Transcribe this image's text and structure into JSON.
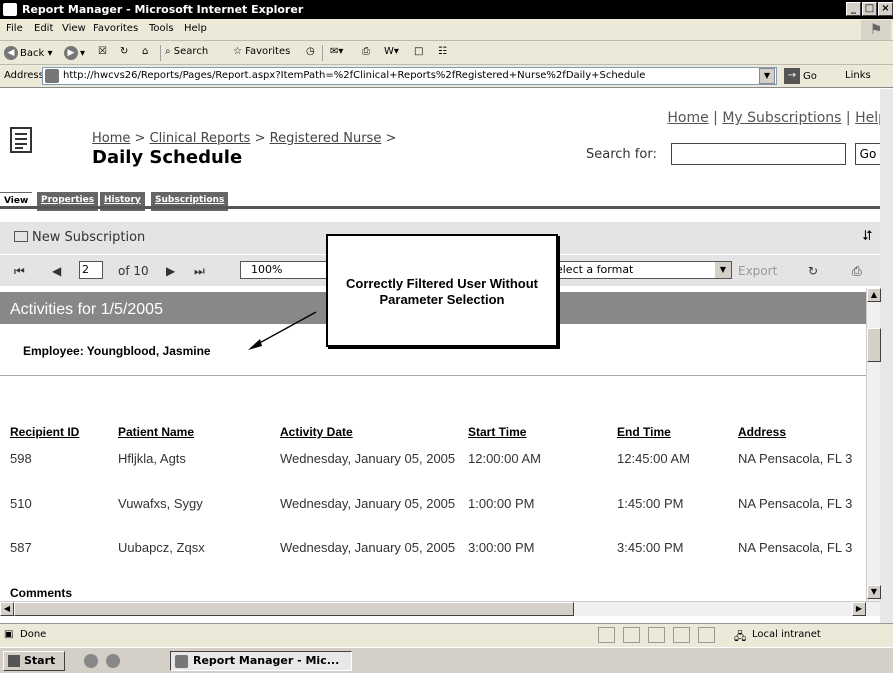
{
  "window": {
    "title": "Report Manager - Microsoft Internet Explorer",
    "min_label": "_",
    "max_label": "□",
    "close_label": "×"
  },
  "menu": [
    "File",
    "Edit",
    "View",
    "Favorites",
    "Tools",
    "Help"
  ],
  "toolbar": {
    "back": "Back",
    "search": "Search",
    "favorites": "Favorites"
  },
  "address": {
    "label": "Address",
    "url": "http://hwcvs26/Reports/Pages/Report.aspx?ItemPath=%2fClinical+Reports%2fRegistered+Nurse%2fDaily+Schedule",
    "go": "Go",
    "links": "Links"
  },
  "header": {
    "breadcrumb": {
      "home": "Home",
      "sep1": " > ",
      "folder1": "Clinical Reports",
      "sep2": " > ",
      "folder2": "Registered Nurse",
      "sep3": " >"
    },
    "title": "Daily Schedule",
    "links": {
      "home": "Home",
      "sep1": " | ",
      "subscriptions": "My Subscriptions",
      "sep2": " | ",
      "help": "Help"
    },
    "search_label": "Search for:",
    "search_value": "",
    "search_go": "Go"
  },
  "tabs": [
    {
      "label": "View"
    },
    {
      "label": "Properties"
    },
    {
      "label": "History"
    },
    {
      "label": "Subscriptions"
    }
  ],
  "subscription_bar": {
    "new_subscription": "New Subscription",
    "collapse_icon": "⮃"
  },
  "viewer": {
    "page": "2",
    "of_pages": "of 10",
    "zoom": "100%",
    "format": "Select a format",
    "export": "Export"
  },
  "report": {
    "title": "Activities for 1/5/2005",
    "employee": "Employee: Youngblood, Jasmine",
    "columns": [
      "Recipient ID",
      "Patient Name",
      "Activity Date",
      "Start Time",
      "End Time",
      "Address"
    ],
    "rows": [
      {
        "recipient_id": "598",
        "patient": "Hfljkla, Agts",
        "date": "Wednesday, January 05, 2005",
        "start": "12:00:00 AM",
        "end": "12:45:00 AM",
        "address": "NA Pensacola, FL 3"
      },
      {
        "recipient_id": "510",
        "patient": "Vuwafxs, Sygy",
        "date": "Wednesday, January 05, 2005",
        "start": "1:00:00 PM",
        "end": "1:45:00 PM",
        "address": "NA Pensacola, FL 3"
      },
      {
        "recipient_id": "587",
        "patient": "Uubapcz, Zqsx",
        "date": "Wednesday, January 05, 2005",
        "start": "3:00:00 PM",
        "end": "3:45:00 PM",
        "address": "NA Pensacola, FL 3"
      }
    ],
    "comments": "Comments"
  },
  "callout": {
    "text": "Correctly Filtered User Without Parameter Selection"
  },
  "status": {
    "text": "Done",
    "zone": "Local intranet"
  },
  "taskbar": {
    "start": "Start",
    "task": "Report Manager - Mic..."
  }
}
